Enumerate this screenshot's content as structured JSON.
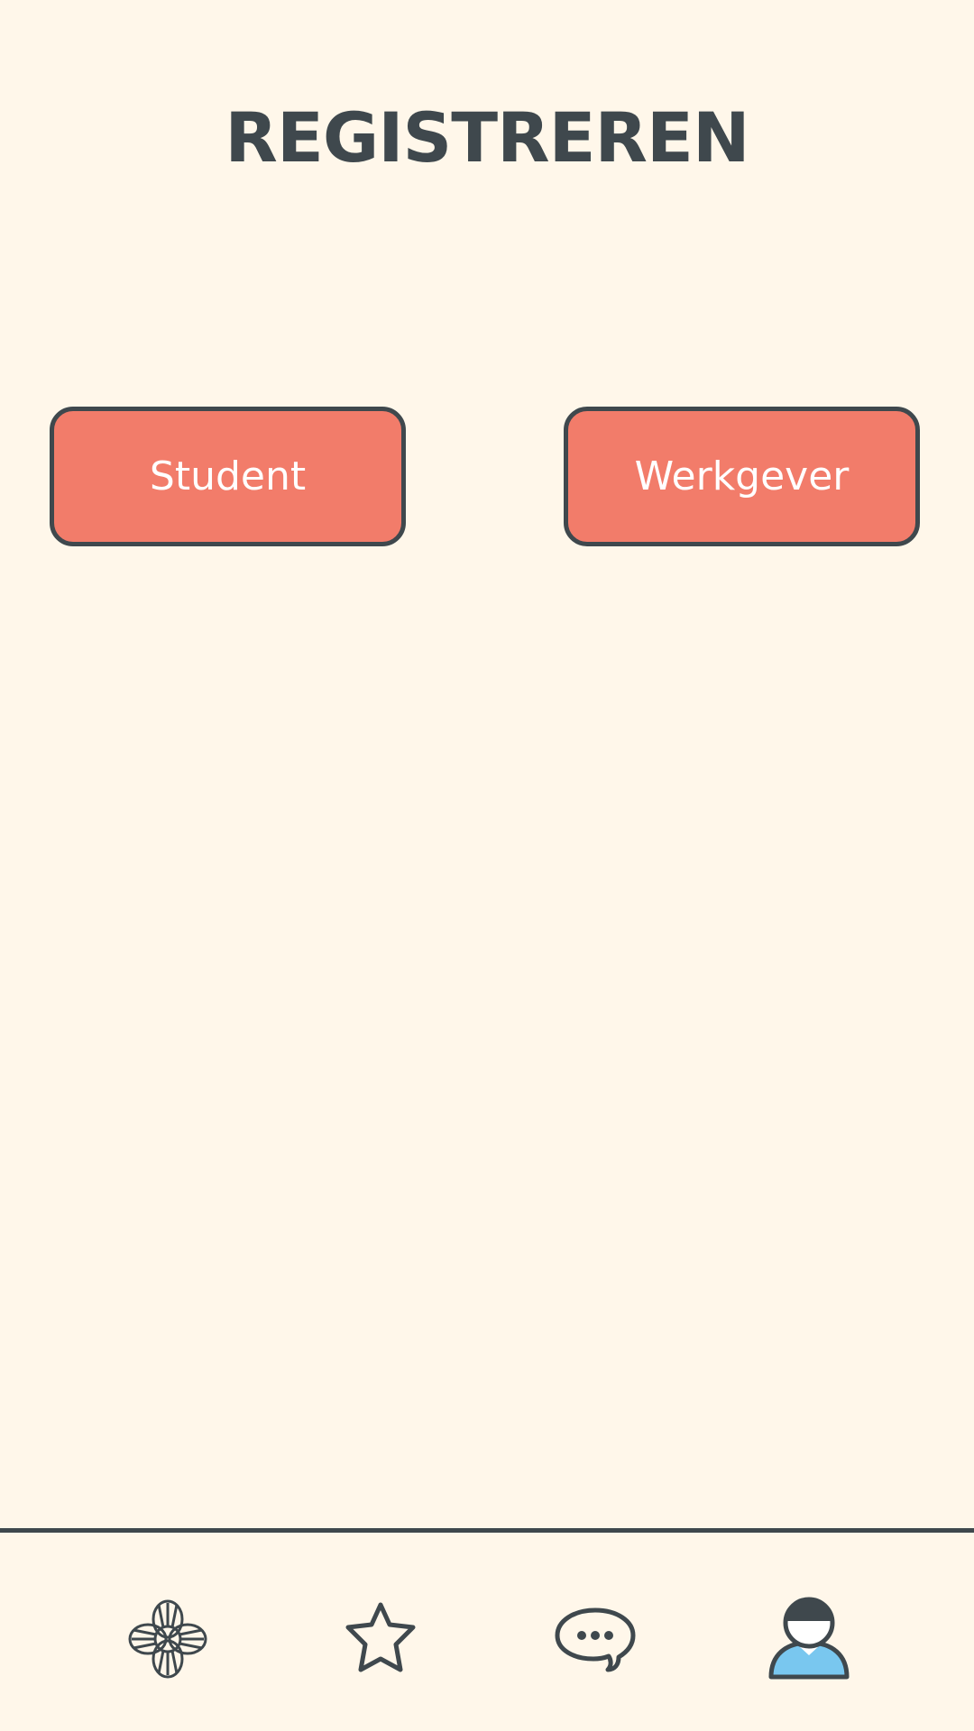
{
  "header": {
    "title": "REGISTREREN"
  },
  "roles": {
    "student_label": "Student",
    "employer_label": "Werkgever"
  },
  "bottom_nav": {
    "items": [
      {
        "icon": "lifebuoy-icon",
        "active": false
      },
      {
        "icon": "star-icon",
        "active": false
      },
      {
        "icon": "chat-bubble-icon",
        "active": false
      },
      {
        "icon": "user-icon",
        "active": true
      }
    ]
  },
  "colors": {
    "background": "#fff7ea",
    "button": "#f27c6a",
    "outline": "#3f484d",
    "button_text": "#ffffff",
    "accent_blue": "#79c7ef"
  }
}
